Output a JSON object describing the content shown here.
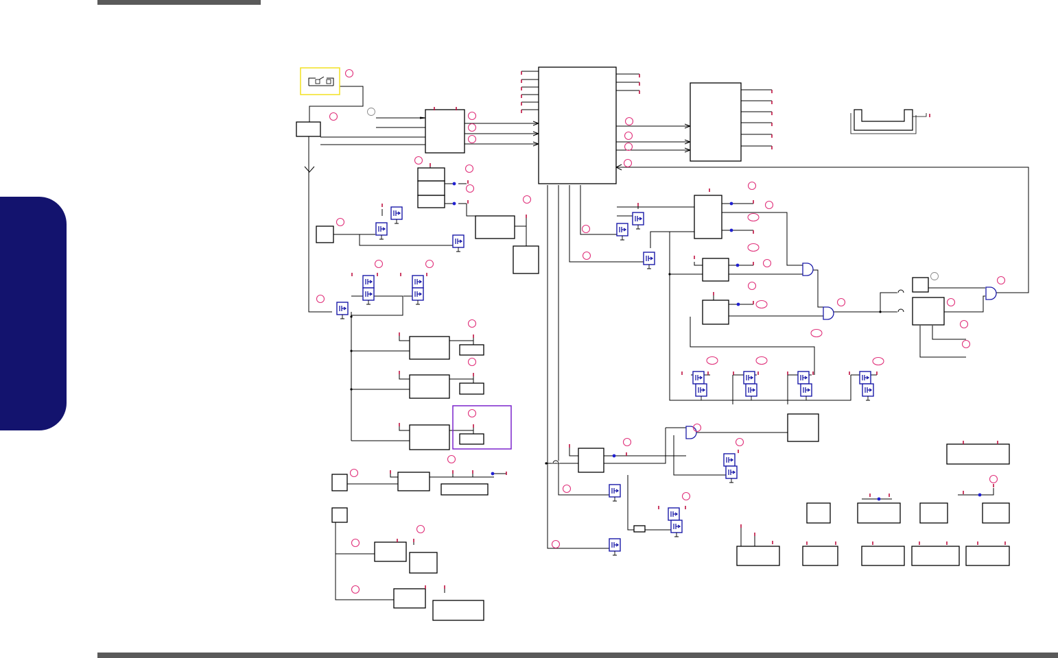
{
  "page": {
    "title": "",
    "accent_color": "#13136e",
    "bar_color": "#5a5a5a",
    "callout_color": "#e0307a",
    "wire_color": "#000000",
    "mosfet_color": "#1a1aa8",
    "highlight_yellow": "#f2e020",
    "highlight_purple": "#7a22cc"
  },
  "schematic": {
    "labels": []
  }
}
